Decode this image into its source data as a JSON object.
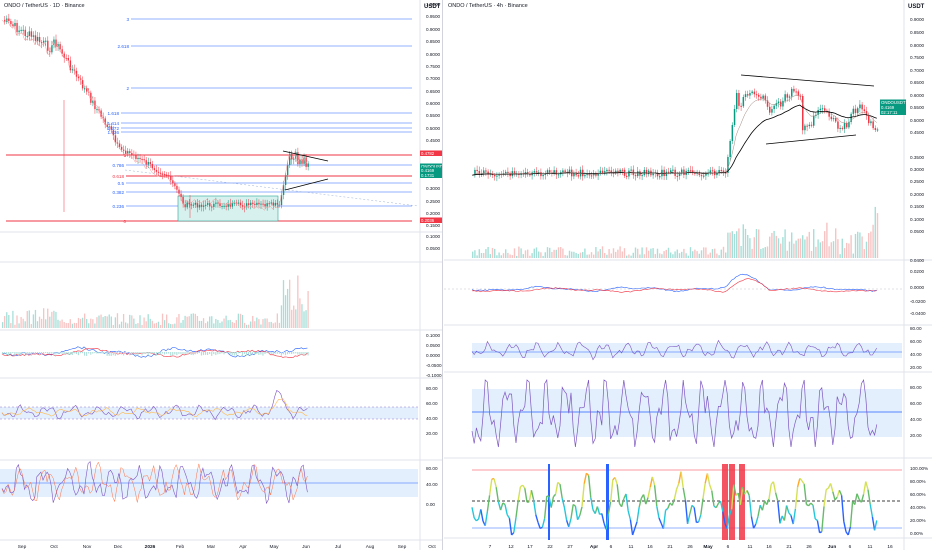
{
  "left": {
    "title": "ONDO / TetherUS · 1D · Binance",
    "currency": "USDT",
    "fib_levels": [
      {
        "label": "3",
        "color": "#2962ff"
      },
      {
        "label": "2.618",
        "color": "#2962ff"
      },
      {
        "label": "2",
        "color": "#2962ff"
      },
      {
        "label": "1.618",
        "color": "#2962ff"
      },
      {
        "label": "1.414",
        "color": "#2962ff"
      },
      {
        "label": "1.272",
        "color": "#2962ff"
      },
      {
        "label": "1.236",
        "color": "#2962ff"
      },
      {
        "label": "1",
        "color": "#f23645"
      },
      {
        "label": "0.786",
        "color": "#2962ff"
      },
      {
        "label": "0.618",
        "color": "#f23645"
      },
      {
        "label": "0.5",
        "color": "#2962ff"
      },
      {
        "label": "0.382",
        "color": "#2962ff"
      },
      {
        "label": "0.236",
        "color": "#2962ff"
      },
      {
        "label": "0",
        "color": "#f23645"
      }
    ],
    "price_axis": [
      "1.0000",
      "0.9500",
      "0.9000",
      "0.8500",
      "0.8000",
      "0.7500",
      "0.7000",
      "0.6500",
      "0.6000",
      "0.5500",
      "0.5000",
      "0.4500",
      "0.3500",
      "0.3000",
      "0.2500",
      "0.2000",
      "0.1500",
      "0.1000",
      "0.0500"
    ],
    "macd_axis": [
      "0.1000",
      "0.0500",
      "0.0000",
      "-0.0500",
      "-0.1000"
    ],
    "rsi_axis": [
      "80.00",
      "60.00",
      "40.00",
      "20.00"
    ],
    "stoch_axis": [
      "80.00",
      "40.00",
      "0.00"
    ],
    "badges": [
      {
        "label": "0.4782",
        "color": "#f23645"
      },
      {
        "label": "ONDOUSDT",
        "color": "#089981"
      },
      {
        "label": "0.4169",
        "color": "#089981"
      },
      {
        "label": "0.1731",
        "color": "#089981"
      },
      {
        "label": "0.2036",
        "color": "#f23645"
      }
    ],
    "time_axis": [
      "Sep",
      "Oct",
      "Nov",
      "Dec",
      "2026",
      "Feb",
      "Mar",
      "Apr",
      "May",
      "Jun",
      "Jul",
      "Aug",
      "Sep",
      "Oct"
    ]
  },
  "right": {
    "title": "ONDO / TetherUS · 4h · Binance",
    "currency": "USDT",
    "price_axis": [
      "0.9000",
      "0.8500",
      "0.8000",
      "0.7500",
      "0.7000",
      "0.6500",
      "0.6000",
      "0.5500",
      "0.5000",
      "0.4500",
      "0.3500",
      "0.3000",
      "0.2500",
      "0.2000",
      "0.1500",
      "0.1000",
      "0.0500"
    ],
    "macd_axis": [
      "0.0400",
      "0.0200",
      "0.0000",
      "-0.0200",
      "-0.0400"
    ],
    "rsi_axis": [
      "80.00",
      "60.00",
      "40.00",
      "20.00"
    ],
    "stoch_axis": [
      "80.00",
      "60.00",
      "40.00",
      "20.00"
    ],
    "pct_axis": [
      "100.00%",
      "80.00%",
      "60.00%",
      "40.00%",
      "20.00%",
      "0.00%"
    ],
    "badges": [
      {
        "label": "ONDOUSDT",
        "color": "#089981"
      },
      {
        "label": "0.4169",
        "color": "#089981"
      },
      {
        "label": "02:17:11",
        "color": "#089981"
      }
    ],
    "time_axis": [
      "7",
      "12",
      "17",
      "22",
      "27",
      "Apr",
      "6",
      "11",
      "16",
      "21",
      "26",
      "May",
      "6",
      "11",
      "16",
      "21",
      "26",
      "Jun",
      "6",
      "11",
      "16"
    ]
  },
  "colors": {
    "up": "#089981",
    "down": "#f23645",
    "fib": "#2962ff",
    "rsi": "#7e57c2",
    "band": "#e3effd"
  }
}
